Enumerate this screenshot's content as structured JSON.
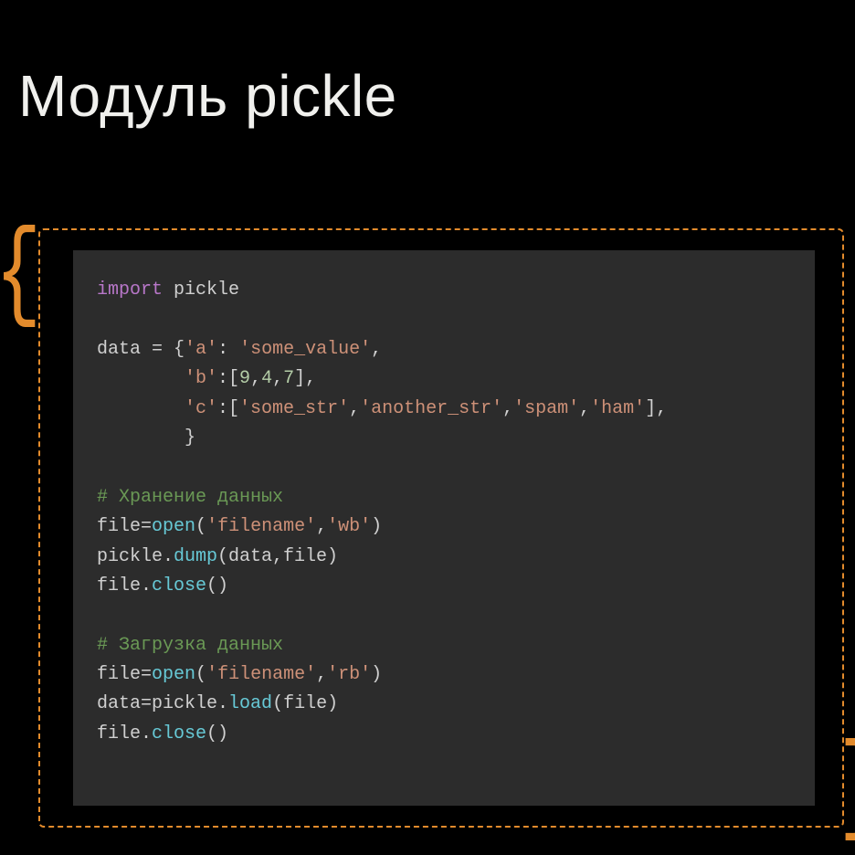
{
  "title": "Модуль pickle",
  "brace_left": "{",
  "brace_right": "}",
  "code": {
    "t1": "import",
    "t2": " pickle",
    "blank1": "",
    "l3a": "data ",
    "l3b": "=",
    "l3c": " {",
    "l3d": "'a'",
    "l3e": ": ",
    "l3f": "'some_value'",
    "l3g": ",",
    "l4a": "        ",
    "l4b": "'b'",
    "l4c": ":[",
    "l4d": "9",
    "l4e": ",",
    "l4f": "4",
    "l4g": ",",
    "l4h": "7",
    "l4i": "],",
    "l5a": "        ",
    "l5b": "'c'",
    "l5c": ":[",
    "l5d": "'some_str'",
    "l5e": ",",
    "l5f": "'another_str'",
    "l5g": ",",
    "l5h": "'spam'",
    "l5i": ",",
    "l5j": "'ham'",
    "l5k": "],",
    "l6a": "        }",
    "blank2": "",
    "c1": "# Хранение данных",
    "l8a": "file",
    "l8b": "=",
    "l8c": "open",
    "l8d": "(",
    "l8e": "'filename'",
    "l8f": ",",
    "l8g": "'wb'",
    "l8h": ")",
    "l9a": "pickle.",
    "l9b": "dump",
    "l9c": "(data,file)",
    "l10a": "file.",
    "l10b": "close",
    "l10c": "()",
    "blank3": "",
    "c2": "# Загрузка данных",
    "l12a": "file",
    "l12b": "=",
    "l12c": "open",
    "l12d": "(",
    "l12e": "'filename'",
    "l12f": ",",
    "l12g": "'rb'",
    "l12h": ")",
    "l13a": "data",
    "l13b": "=",
    "l13c": "pickle.",
    "l13d": "load",
    "l13e": "(file)",
    "l14a": "file.",
    "l14b": "close",
    "l14c": "()"
  }
}
